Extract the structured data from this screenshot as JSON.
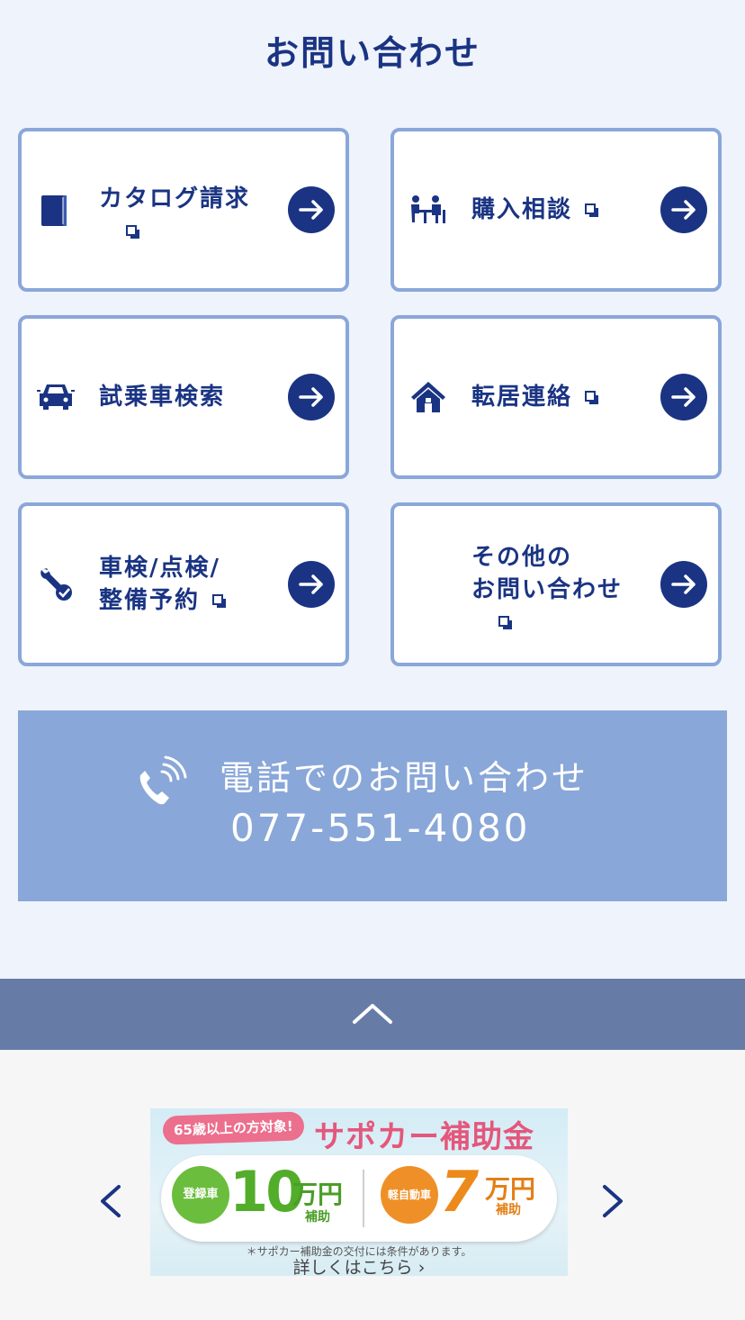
{
  "page_title": "お問い合わせ",
  "cards": [
    {
      "id": "catalog",
      "label_line1": "カタログ請求",
      "label_line2": "",
      "icon": "catalog-book-icon",
      "external": true,
      "ext_newline": true
    },
    {
      "id": "purchase",
      "label_line1": "購入相談",
      "label_line2": "",
      "icon": "consultation-people-icon",
      "external": true,
      "ext_newline": false
    },
    {
      "id": "testdrive",
      "label_line1": "試乗車検索",
      "label_line2": "",
      "icon": "car-icon",
      "external": false,
      "ext_newline": false
    },
    {
      "id": "moving",
      "label_line1": "転居連絡",
      "label_line2": "",
      "icon": "house-icon",
      "external": true,
      "ext_newline": false
    },
    {
      "id": "inspection",
      "label_line1": "車検/点検/",
      "label_line2": "整備予約",
      "icon": "wrench-icon",
      "external": true,
      "ext_newline": false
    },
    {
      "id": "other",
      "label_line1": "その他の",
      "label_line2": "お問い合わせ",
      "icon": "",
      "external": true,
      "ext_newline": true
    }
  ],
  "phone": {
    "label": "電話でのお問い合わせ",
    "number": "077-551-4080",
    "icon": "phone-icon"
  },
  "page_top": {
    "icon": "chevron-up-icon"
  },
  "carousel": {
    "prev_icon": "chevron-left-icon",
    "next_icon": "chevron-right-icon",
    "banner": {
      "badge": "65歳以上の方対象!",
      "title": "サポカー補助金",
      "registered_label": "登録車",
      "registered_amount": "10",
      "registered_unit": "万円",
      "registered_sub": "補助",
      "kei_label": "軽自動車",
      "kei_amount": "7",
      "kei_unit": "万円",
      "kei_sub": "補助",
      "note": "＊サポカー補助金の交付には条件があります。",
      "more": "詳しくはこちら ›"
    }
  },
  "colors": {
    "accent": "#1a3483",
    "card_border": "#8aa7da",
    "phone_bg": "#89a7d8",
    "pagetop_bg": "#677ba7",
    "background": "#eff3fb"
  }
}
